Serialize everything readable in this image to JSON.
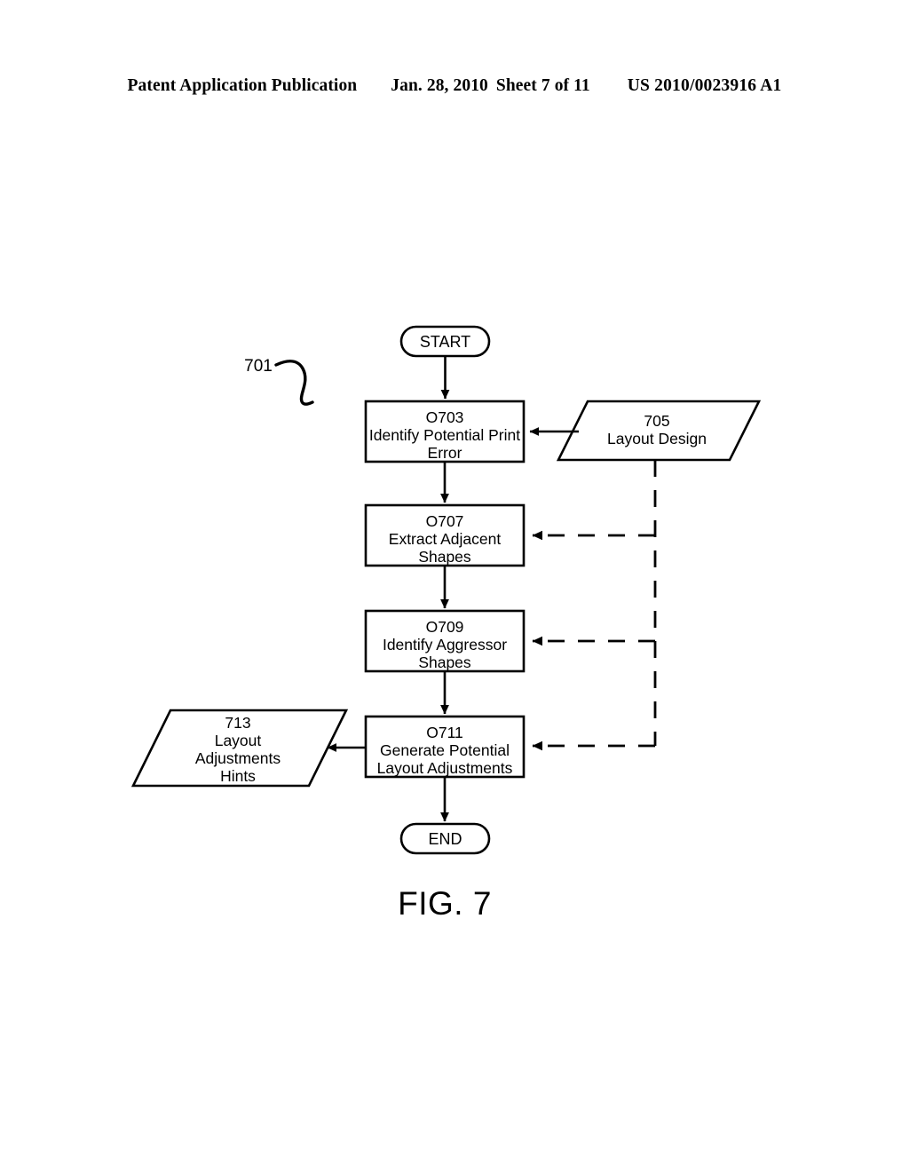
{
  "header": {
    "publication": "Patent Application Publication",
    "date": "Jan. 28, 2010",
    "sheet": "Sheet 7 of 11",
    "document_number": "US 2010/0023916 A1"
  },
  "figure": {
    "caption": "FIG. 7",
    "diagram_reference": "701"
  },
  "flowchart": {
    "start_label": "START",
    "end_label": "END",
    "steps": [
      {
        "id": "O703",
        "number": "O703",
        "line1": "Identify Potential Print",
        "line2": "Error"
      },
      {
        "id": "O707",
        "number": "O707",
        "line1": "Extract Adjacent",
        "line2": "Shapes"
      },
      {
        "id": "O709",
        "number": "O709",
        "line1": "Identify Aggressor",
        "line2": "Shapes"
      },
      {
        "id": "O711",
        "number": "O711",
        "line1": "Generate Potential",
        "line2": "Layout Adjustments"
      }
    ],
    "data_inputs": [
      {
        "id": "705",
        "number": "705",
        "line1": "Layout Design",
        "line2": "",
        "line3": "",
        "position": "right"
      }
    ],
    "data_outputs": [
      {
        "id": "713",
        "number": "713",
        "line1": "Layout",
        "line2": "Adjustments",
        "line3": "Hints",
        "position": "left"
      }
    ]
  },
  "colors": {
    "ink": "#000000",
    "paper": "#ffffff"
  }
}
